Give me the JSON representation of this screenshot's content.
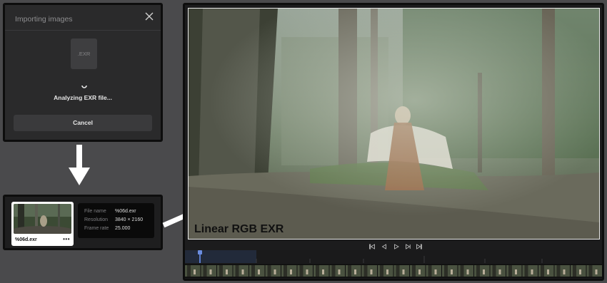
{
  "dialog": {
    "title": "Importing images",
    "file_badge": ".EXR",
    "status": "Analyzing EXR file...",
    "cancel_label": "Cancel"
  },
  "asset": {
    "name": "%06d.exr",
    "more_label": "•••",
    "info": [
      {
        "key": "File name",
        "value": "%06d.exr"
      },
      {
        "key": "Resolution",
        "value": "3840 × 2160"
      },
      {
        "key": "Frame rate",
        "value": "25.000"
      }
    ]
  },
  "viewer": {
    "caption": "Linear RGB EXR"
  },
  "colors": {
    "arrow": "#ffffff",
    "playhead": "#5a7ac8",
    "dialog_bg": "#2a2a2b"
  },
  "icons": [
    "close-icon",
    "exr-file-icon",
    "loading-spinner-icon",
    "skip-to-start-icon",
    "step-back-icon",
    "play-icon",
    "step-forward-icon",
    "skip-to-end-icon",
    "more-icon"
  ]
}
